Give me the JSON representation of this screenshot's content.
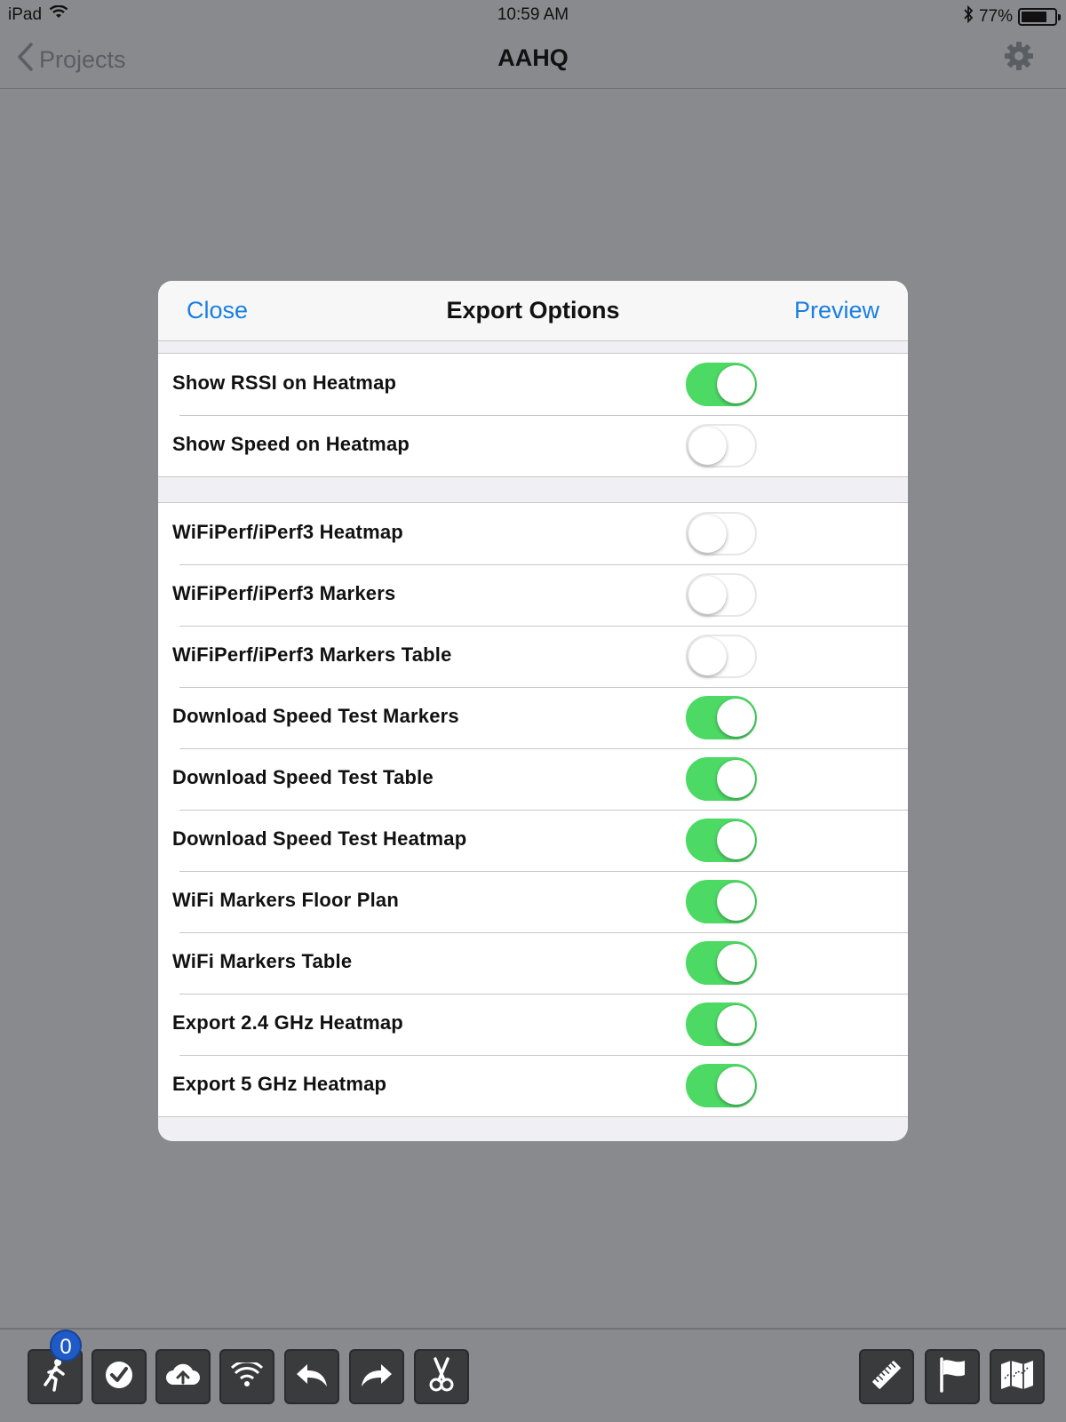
{
  "status_bar": {
    "device": "iPad",
    "time": "10:59 AM",
    "battery": "77%",
    "battery_level": 0.77
  },
  "nav": {
    "back_label": "Projects",
    "title": "AAHQ"
  },
  "modal": {
    "close_label": "Close",
    "title": "Export Options",
    "preview_label": "Preview",
    "group1": [
      {
        "label": "Show RSSI on Heatmap",
        "on": true
      },
      {
        "label": "Show Speed on Heatmap",
        "on": false
      }
    ],
    "group2": [
      {
        "label": "WiFiPerf/iPerf3 Heatmap",
        "on": false
      },
      {
        "label": "WiFiPerf/iPerf3 Markers",
        "on": false
      },
      {
        "label": "WiFiPerf/iPerf3 Markers Table",
        "on": false
      },
      {
        "label": "Download Speed Test Markers",
        "on": true
      },
      {
        "label": "Download Speed Test Table",
        "on": true
      },
      {
        "label": "Download Speed Test Heatmap",
        "on": true
      },
      {
        "label": "WiFi Markers Floor Plan",
        "on": true
      },
      {
        "label": "WiFi Markers Table",
        "on": true
      },
      {
        "label": "Export 2.4 GHz Heatmap",
        "on": true
      },
      {
        "label": "Export 5 GHz Heatmap",
        "on": true
      }
    ]
  },
  "toolbar": {
    "badge_count": "0",
    "left_icons": [
      "walk-icon",
      "checkmark-icon",
      "cloud-upload-icon",
      "wifi-icon",
      "undo-icon",
      "redo-icon",
      "scissors-icon"
    ],
    "right_icons": [
      "ruler-icon",
      "flag-icon",
      "map-icon"
    ]
  },
  "colors": {
    "accent": "#1a7fe0",
    "toggle_on": "#4cd964",
    "badge": "#1e5bc6"
  }
}
